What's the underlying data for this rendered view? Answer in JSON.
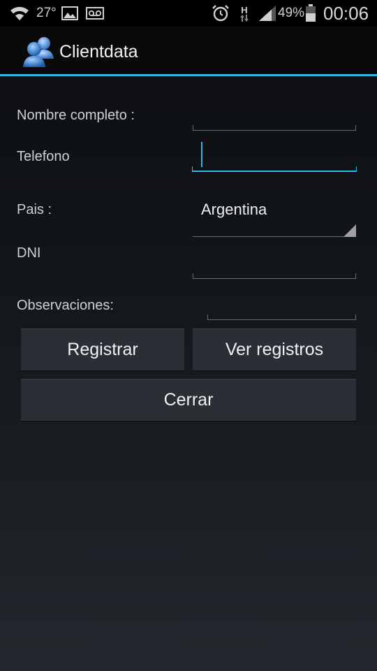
{
  "status_bar": {
    "temperature": "27°",
    "network_type": "H",
    "battery_percent": "49%",
    "time": "00:06",
    "icons": [
      "wifi-icon",
      "image-icon",
      "voicemail-icon",
      "alarm-icon",
      "data-arrows-icon",
      "signal-icon",
      "battery-icon"
    ]
  },
  "action_bar": {
    "title": "Clientdata",
    "icon": "users-icon"
  },
  "form": {
    "nombre_label": "Nombre completo :",
    "telefono_label": "Telefono",
    "pais_label": "Pais :",
    "pais_value": "Argentina",
    "dni_label": "DNI",
    "observaciones_label": "Observaciones:"
  },
  "buttons": {
    "registrar": "Registrar",
    "ver_registros": "Ver registros",
    "cerrar": "Cerrar"
  },
  "colors": {
    "accent": "#33b5e5",
    "button_bg": "#2b2f35"
  }
}
